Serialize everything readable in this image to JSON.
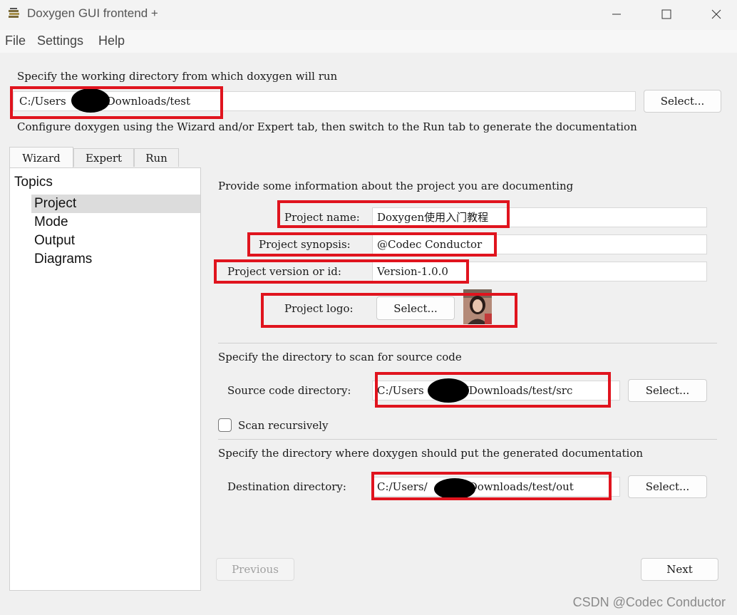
{
  "window": {
    "title": "Doxygen GUI frontend +",
    "controls": {
      "minimize": "minimize-icon",
      "maximize": "maximize-icon",
      "close": "close-icon"
    }
  },
  "menu": {
    "items": [
      "File",
      "Settings",
      "Help"
    ]
  },
  "workdir": {
    "label": "Specify the working directory from which doxygen will run",
    "value_prefix": "C:/Users",
    "value_suffix": "/Downloads/test",
    "select_label": "Select...",
    "hint": "Configure doxygen using the Wizard and/or Expert tab, then switch to the Run tab to generate the documentation"
  },
  "tabs": [
    "Wizard",
    "Expert",
    "Run"
  ],
  "active_tab": "Wizard",
  "topics": {
    "heading": "Topics",
    "items": [
      "Project",
      "Mode",
      "Output",
      "Diagrams"
    ],
    "selected": "Project"
  },
  "project": {
    "intro": "Provide some information about the project you are documenting",
    "name_label": "Project name:",
    "name_value": "Doxygen使用入门教程",
    "synopsis_label": "Project synopsis:",
    "synopsis_value": "@Codec Conductor",
    "version_label": "Project version or id:",
    "version_value": "Version-1.0.0",
    "logo_label": "Project logo:",
    "logo_button": "Select..."
  },
  "source": {
    "intro": "Specify the directory to scan for source code",
    "label": "Source code directory:",
    "value_prefix": "C:/Users",
    "value_suffix": "/Downloads/test/src",
    "select_label": "Select...",
    "recursive_label": "Scan recursively",
    "recursive_checked": false
  },
  "destination": {
    "intro": "Specify the directory where doxygen should put the generated documentation",
    "label": "Destination directory:",
    "value_prefix": "C:/Users/",
    "value_suffix": "Downloads/test/out",
    "select_label": "Select..."
  },
  "nav": {
    "previous": "Previous",
    "next": "Next"
  },
  "watermark": "CSDN @Codec Conductor",
  "colors": {
    "highlight": "#e0141e",
    "selection": "#dcdcdc"
  }
}
